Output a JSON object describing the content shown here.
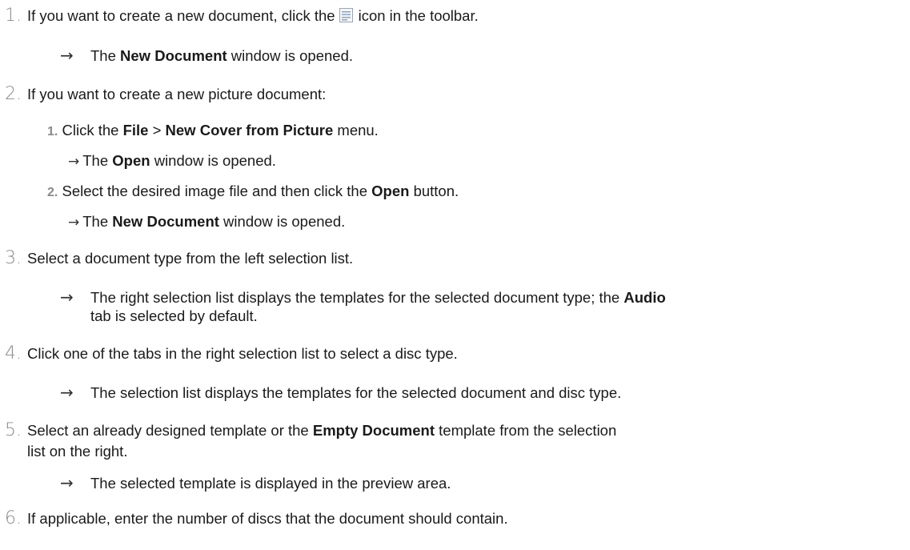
{
  "steps": [
    {
      "num": "1.",
      "pre": "If you want to create a new document, click the",
      "icon": "new-document-icon",
      "post": "icon in the toolbar.",
      "result": {
        "pre": "The ",
        "bold": "New Document",
        "post": " window is opened."
      }
    },
    {
      "num": "2.",
      "text": "If you want to create a new picture document:",
      "substeps": [
        {
          "num": "1.",
          "t1": "Click the ",
          "b1": "File",
          "t2": " > ",
          "b2": "New Cover from Picture",
          "t3": " menu.",
          "result": {
            "pre": "The ",
            "bold": "Open",
            "post": " window is opened."
          }
        },
        {
          "num": "2.",
          "t1": "Select the desired image file and then click the ",
          "b1": "Open",
          "t2": " button.",
          "result": {
            "pre": "The ",
            "bold": "New Document",
            "post": " window is opened."
          }
        }
      ]
    },
    {
      "num": "3.",
      "text": "Select a document type from the left selection list.",
      "result": {
        "pre": "The right selection list displays the templates for the selected document type; the ",
        "bold": "Audio",
        "post": "tab is selected by default."
      }
    },
    {
      "num": "4.",
      "text": "Click one of the tabs in the right selection list to select a disc type.",
      "result": {
        "text": "The selection list displays the templates for the selected document and disc type."
      }
    },
    {
      "num": "5.",
      "t1": "Select an already designed template or the ",
      "b1": "Empty Document",
      "t2": " template from the selection",
      "line2": "list on the right.",
      "result": {
        "text": "The selected template is displayed in the preview area."
      }
    },
    {
      "num": "6.",
      "text": "If applicable, enter the number of discs that the document should contain."
    }
  ],
  "arrow_glyph": "→"
}
